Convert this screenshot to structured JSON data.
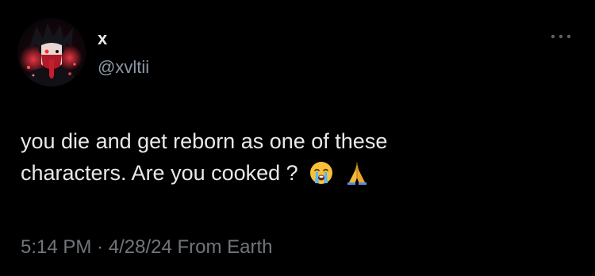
{
  "user": {
    "display_name": "x",
    "handle": "@xvltii",
    "avatar_icon": "anime-avatar-icon"
  },
  "post": {
    "text_line1": "you die and get reborn as one of these",
    "text_line2": "characters. Are you cooked ?",
    "emojis": [
      "loudly-crying-face-icon",
      "folded-hands-icon"
    ]
  },
  "meta": {
    "time": "5:14 PM",
    "separator": "·",
    "date": "4/28/24",
    "source": "From Earth"
  },
  "menu": {
    "icon": "more-options-icon"
  },
  "colors": {
    "background": "#000000",
    "primary_text": "#e7e9ea",
    "secondary_text": "#71767b",
    "avatar_accent": "#c0202e"
  }
}
